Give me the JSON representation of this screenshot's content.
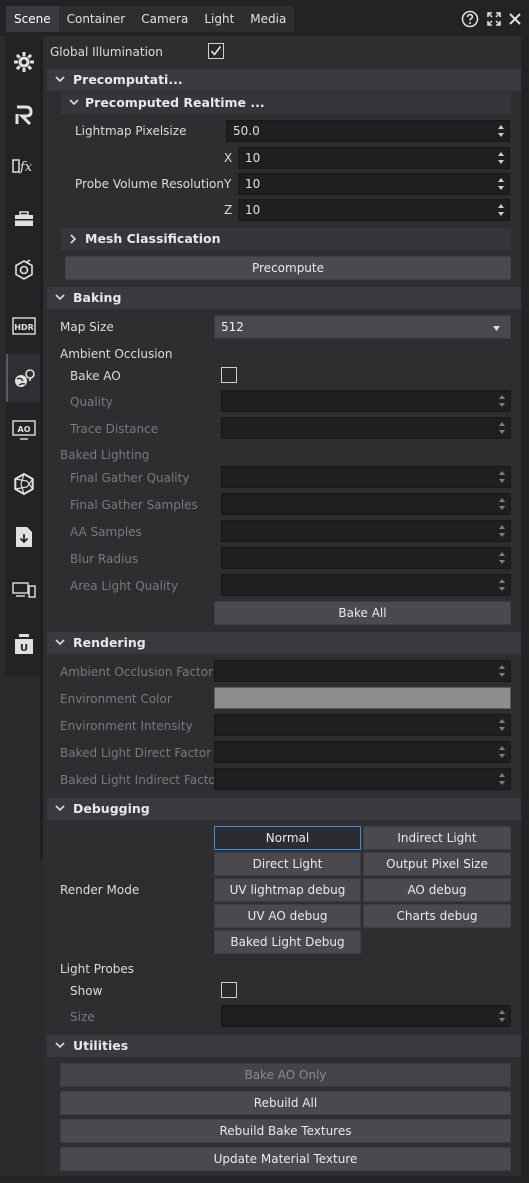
{
  "tabs": [
    "Scene",
    "Container",
    "Camera",
    "Light",
    "Media"
  ],
  "top_icons": [
    "help-icon",
    "maximize-icon",
    "close-icon"
  ],
  "left_icons": [
    "gear-icon",
    "r-icon",
    "fx-icon",
    "toolbox-icon",
    "probe-icon",
    "hdr-icon",
    "global-illumination-icon",
    "ao-icon",
    "aperture-icon",
    "export-icon",
    "devices-icon",
    "u-box-icon"
  ],
  "left_icon_text": {
    "hdr": "HDR",
    "ao": "AO",
    "u": "U"
  },
  "global_illumination": {
    "label": "Global Illumination",
    "checked": true
  },
  "precomputation": {
    "title": "Precomputati...",
    "realtime_title": "Precomputed Realtime ...",
    "lightmap_label": "Lightmap Pixelsize",
    "lightmap_value": "50.0",
    "probe_label": "Probe Volume Resolution",
    "x_label": "X",
    "x_value": "10",
    "y_label": "Y",
    "y_value": "10",
    "z_label": "Z",
    "z_value": "10",
    "mesh_title": "Mesh Classification",
    "precompute_button": "Precompute"
  },
  "baking": {
    "title": "Baking",
    "map_size_label": "Map Size",
    "map_size_value": "512",
    "ambient_occlusion_label": "Ambient Occlusion",
    "bake_ao_label": "Bake AO",
    "quality_label": "Quality",
    "trace_distance_label": "Trace Distance",
    "baked_lighting_label": "Baked Lighting",
    "final_gather_quality_label": "Final Gather Quality",
    "final_gather_samples_label": "Final Gather Samples",
    "aa_samples_label": "AA Samples",
    "blur_radius_label": "Blur Radius",
    "area_light_quality_label": "Area Light Quality",
    "bake_all_button": "Bake All"
  },
  "rendering": {
    "title": "Rendering",
    "ao_factor_label": "Ambient Occlusion Factor",
    "env_color_label": "Environment Color",
    "env_color": "#8d8d90",
    "env_intensity_label": "Environment Intensity",
    "direct_factor_label": "Baked Light Direct Factor",
    "indirect_factor_label": "Baked Light Indirect Factor"
  },
  "debugging": {
    "title": "Debugging",
    "render_mode_label": "Render Mode",
    "modes": [
      "Normal",
      "Indirect Light",
      "Direct Light",
      "Output Pixel Size",
      "UV lightmap debug",
      "AO debug",
      "UV AO debug",
      "Charts debug",
      "Baked Light Debug"
    ],
    "selected_mode": "Normal",
    "light_probes_label": "Light Probes",
    "show_label": "Show",
    "size_label": "Size"
  },
  "utilities": {
    "title": "Utilities",
    "bake_ao_only": "Bake AO Only",
    "rebuild_all": "Rebuild All",
    "rebuild_textures": "Rebuild Bake Textures",
    "update_material": "Update Material Texture"
  },
  "colors": {
    "accent": "#3b8ee0",
    "panel": "#2e2e31",
    "section": "#3a3a3e"
  }
}
